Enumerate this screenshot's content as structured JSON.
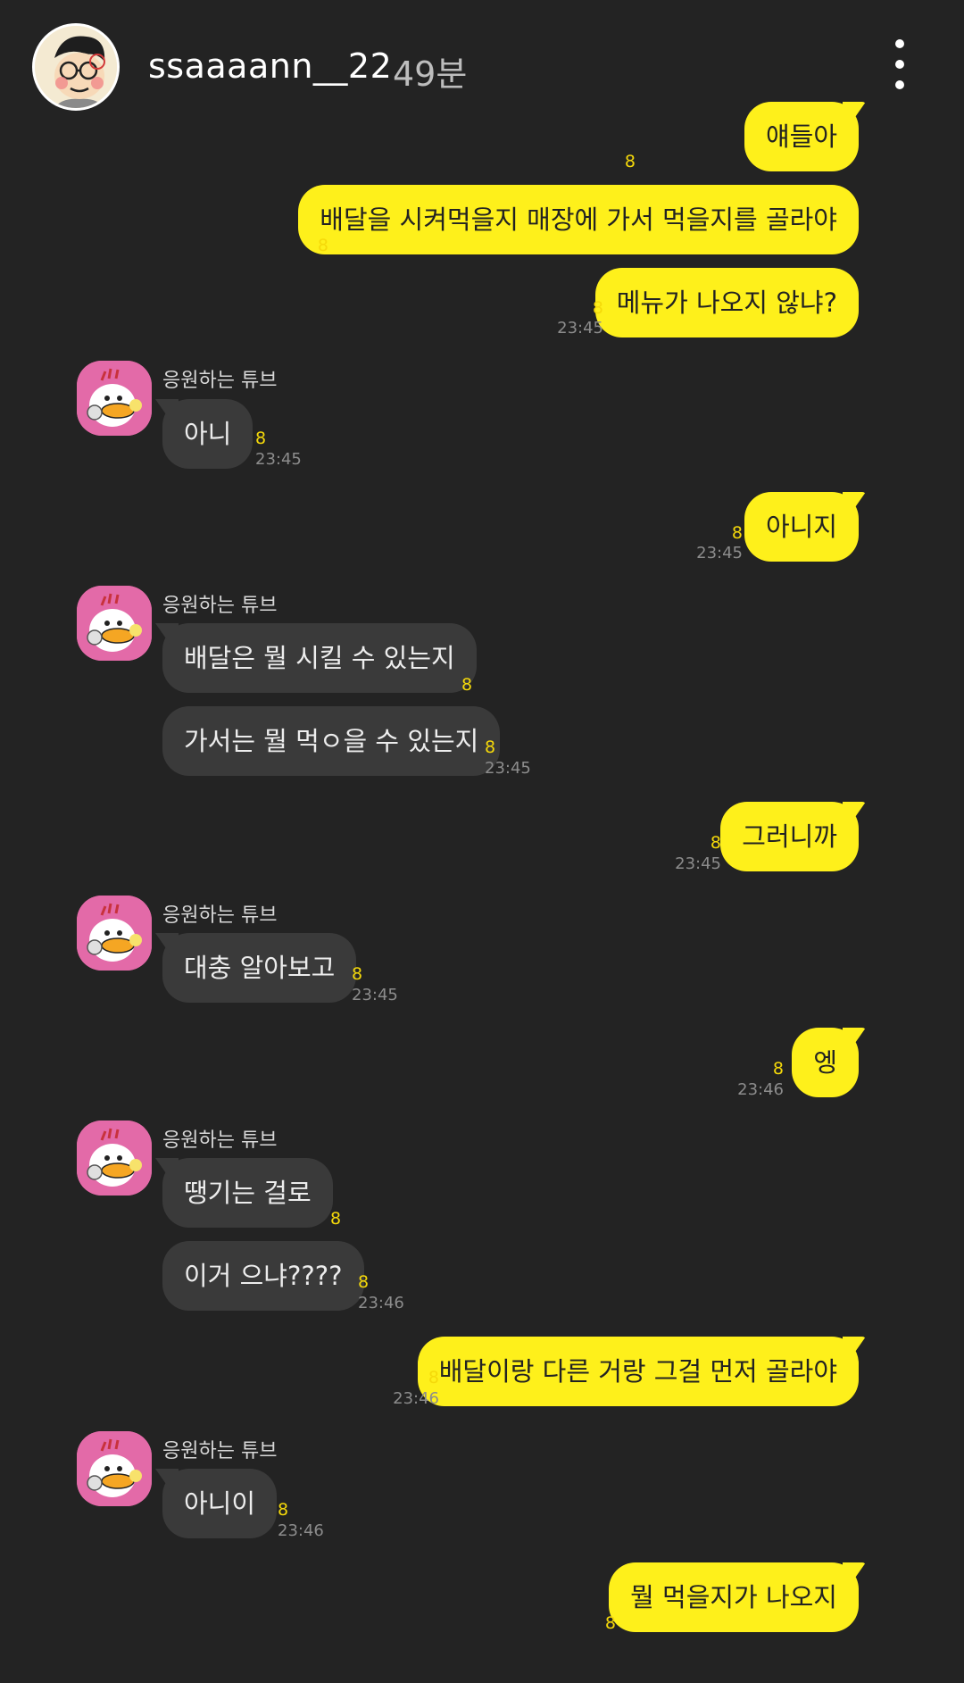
{
  "header": {
    "username": "ssaaaann__22",
    "elapsed": "49분"
  },
  "friend": {
    "name": "응원하는 튜브"
  },
  "unread_mark": "8",
  "messages": [
    {
      "text": "얘들아",
      "time": ""
    },
    {
      "text": "배달을 시켜먹을지 매장에 가서 먹을지를 골라야",
      "time": ""
    },
    {
      "text": "메뉴가 나오지 않냐?",
      "time": "23:45"
    },
    {
      "text": "아니",
      "time": "23:45"
    },
    {
      "text": "아니지",
      "time": "23:45"
    },
    {
      "text": "배달은 뭘 시킬 수 있는지",
      "time": ""
    },
    {
      "text": "가서는 뭘 먹ㅇ을 수 있는지",
      "time": "23:45"
    },
    {
      "text": "그러니까",
      "time": "23:45"
    },
    {
      "text": "대충 알아보고",
      "time": "23:45"
    },
    {
      "text": "엥",
      "time": "23:46"
    },
    {
      "text": "땡기는 걸로",
      "time": ""
    },
    {
      "text": "이거 으냐????",
      "time": "23:46"
    },
    {
      "text": "배달이랑 다른 거랑 그걸 먼저 골라야",
      "time": "23:46"
    },
    {
      "text": "아니이",
      "time": "23:46"
    },
    {
      "text": "뭘 먹을지가 나오지",
      "time": ""
    }
  ]
}
